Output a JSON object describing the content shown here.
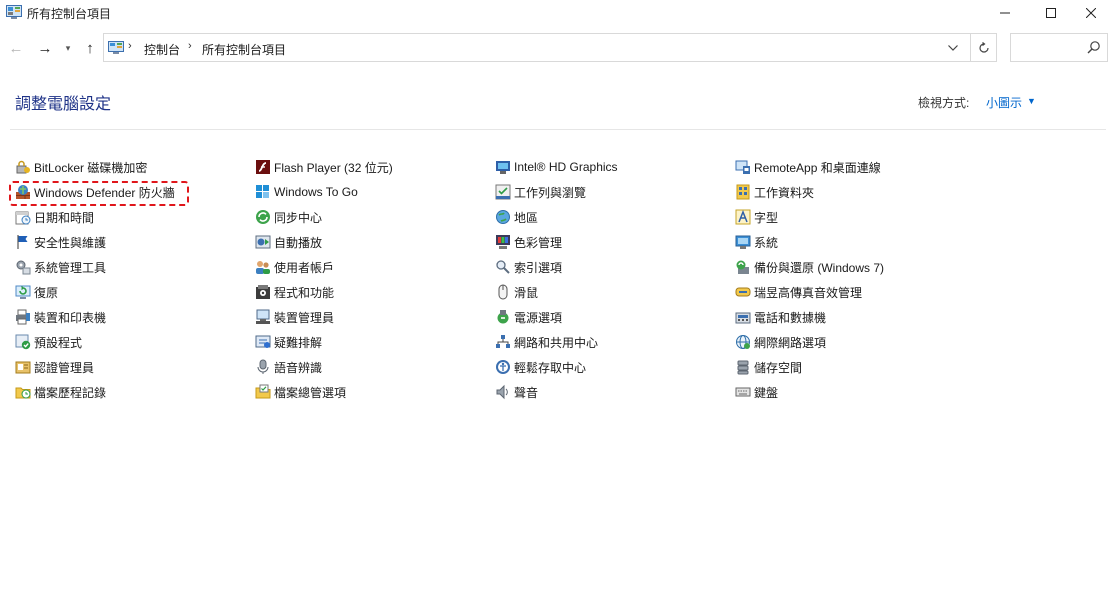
{
  "window": {
    "title": "所有控制台項目",
    "min_icon": "minimize-icon",
    "max_icon": "maximize-icon",
    "close_icon": "close-icon"
  },
  "nav": {
    "breadcrumbs": [
      "控制台",
      "所有控制台項目"
    ],
    "search_placeholder": ""
  },
  "header": {
    "title": "調整電腦設定",
    "view_by_label": "檢視方式:",
    "view_by_value": "小圖示"
  },
  "colors": {
    "title_blue": "#1e3287",
    "link_blue": "#0066cc",
    "highlight_red": "#e0161b"
  },
  "columns": [
    {
      "items": [
        {
          "label": "BitLocker 磁碟機加密",
          "icon": "bitlocker-icon"
        },
        {
          "label": "Windows Defender 防火牆",
          "icon": "firewall-icon"
        },
        {
          "label": "日期和時間",
          "icon": "clock-icon"
        },
        {
          "label": "安全性與維護",
          "icon": "flag-icon"
        },
        {
          "label": "系統管理工具",
          "icon": "tools-icon"
        },
        {
          "label": "復原",
          "icon": "recovery-icon"
        },
        {
          "label": "裝置和印表機",
          "icon": "printer-icon"
        },
        {
          "label": "預設程式",
          "icon": "default-programs-icon"
        },
        {
          "label": "認證管理員",
          "icon": "credential-icon"
        },
        {
          "label": "檔案歷程記錄",
          "icon": "file-history-icon"
        }
      ]
    },
    {
      "items": [
        {
          "label": "Flash Player (32 位元)",
          "icon": "flash-icon"
        },
        {
          "label": "Windows To Go",
          "icon": "windows-to-go-icon"
        },
        {
          "label": "同步中心",
          "icon": "sync-icon"
        },
        {
          "label": "自動播放",
          "icon": "autoplay-icon"
        },
        {
          "label": "使用者帳戶",
          "icon": "users-icon"
        },
        {
          "label": "程式和功能",
          "icon": "programs-icon"
        },
        {
          "label": "裝置管理員",
          "icon": "device-manager-icon"
        },
        {
          "label": "疑難排解",
          "icon": "troubleshoot-icon"
        },
        {
          "label": "語音辨識",
          "icon": "microphone-icon"
        },
        {
          "label": "檔案總管選項",
          "icon": "folder-options-icon"
        }
      ]
    },
    {
      "items": [
        {
          "label": "Intel® HD Graphics",
          "icon": "intel-graphics-icon"
        },
        {
          "label": "工作列與瀏覽",
          "icon": "taskbar-icon"
        },
        {
          "label": "地區",
          "icon": "globe-icon"
        },
        {
          "label": "色彩管理",
          "icon": "color-management-icon"
        },
        {
          "label": "索引選項",
          "icon": "indexing-icon"
        },
        {
          "label": "滑鼠",
          "icon": "mouse-icon"
        },
        {
          "label": "電源選項",
          "icon": "power-icon"
        },
        {
          "label": "網路和共用中心",
          "icon": "network-icon"
        },
        {
          "label": "輕鬆存取中心",
          "icon": "ease-of-access-icon"
        },
        {
          "label": "聲音",
          "icon": "speaker-icon"
        }
      ]
    },
    {
      "items": [
        {
          "label": "RemoteApp 和桌面連線",
          "icon": "remoteapp-icon"
        },
        {
          "label": "工作資料夾",
          "icon": "work-folders-icon"
        },
        {
          "label": "字型",
          "icon": "font-icon"
        },
        {
          "label": "系統",
          "icon": "system-icon"
        },
        {
          "label": "備份與還原 (Windows 7)",
          "icon": "backup-icon"
        },
        {
          "label": "瑞昱高傳真音效管理",
          "icon": "realtek-audio-icon"
        },
        {
          "label": "電話和數據機",
          "icon": "phone-modem-icon"
        },
        {
          "label": "網際網路選項",
          "icon": "internet-options-icon"
        },
        {
          "label": "儲存空間",
          "icon": "storage-icon"
        },
        {
          "label": "鍵盤",
          "icon": "keyboard-icon"
        }
      ]
    }
  ]
}
